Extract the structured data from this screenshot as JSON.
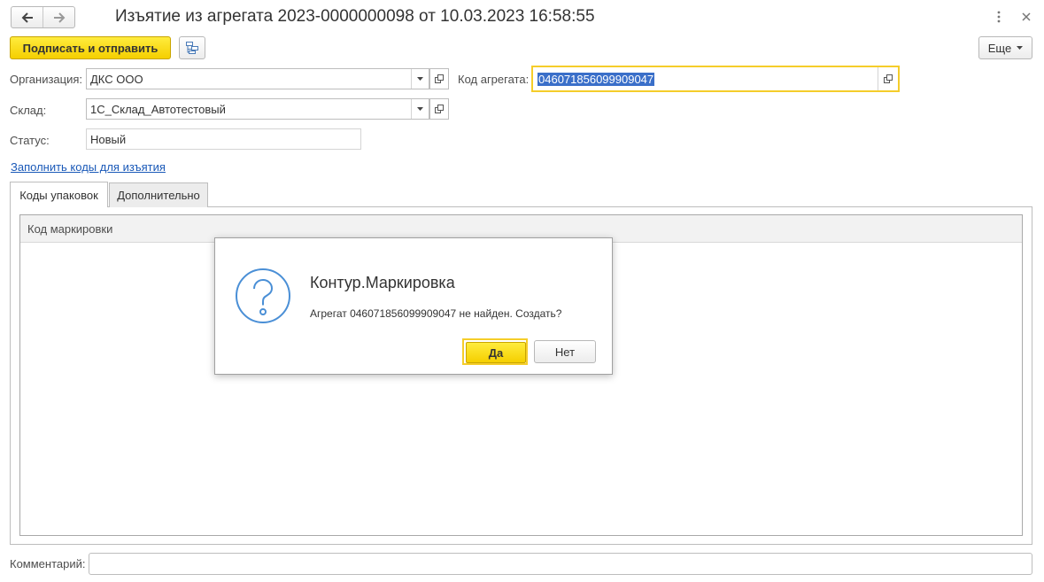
{
  "window": {
    "title": "Изъятие из агрегата 2023-0000000098 от 10.03.2023 16:58:55",
    "back_icon": "arrow-left-icon",
    "forward_icon": "arrow-right-icon",
    "menu_icon": "more-vertical-icon",
    "close_icon": "close-icon"
  },
  "toolbar": {
    "sign_send_label": "Подписать и отправить",
    "structure_icon": "structure-icon",
    "more_label": "Еще"
  },
  "form": {
    "organization": {
      "label": "Организация:",
      "value": "ДКС ООО"
    },
    "warehouse": {
      "label": "Склад:",
      "value": "1С_Склад_Автотестовый"
    },
    "status": {
      "label": "Статус:",
      "value": "Новый"
    },
    "aggregate_code": {
      "label": "Код агрегата:",
      "value": "046071856099909047"
    },
    "fill_codes_link": "Заполнить коды для изъятия",
    "comment": {
      "label": "Комментарий:",
      "value": ""
    }
  },
  "tabs": [
    {
      "label": "Коды упаковок",
      "active": true
    },
    {
      "label": "Дополнительно",
      "active": false
    }
  ],
  "table": {
    "columns": [
      "Код маркировки"
    ],
    "rows": []
  },
  "dialog": {
    "icon": "question-icon",
    "title": "Контур.Маркировка",
    "message": "Агрегат 046071856099909047 не найден. Создать?",
    "yes_label": "Да",
    "no_label": "Нет"
  },
  "colors": {
    "accent_yellow": "#f5cf00",
    "focus_border": "#f5cd2a",
    "link_blue": "#1a59b8",
    "selection_blue": "#3a6fc9",
    "icon_blue": "#4a8fd6"
  }
}
